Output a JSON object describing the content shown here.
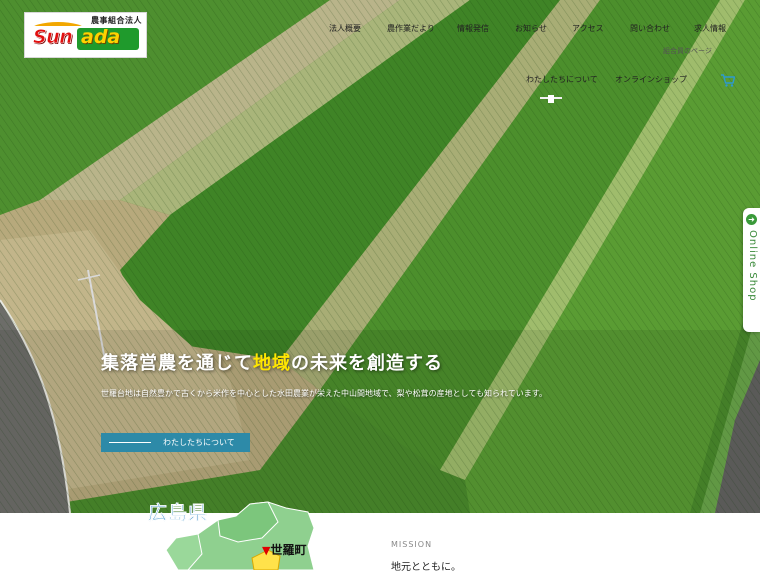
{
  "logo": {
    "subtitle": "農事組合法人",
    "brand_red": "Sun",
    "brand_yellow": "ada"
  },
  "nav": {
    "items": [
      {
        "label": "法人概要"
      },
      {
        "label": "農作業だより"
      },
      {
        "label": "情報発信"
      },
      {
        "label": "お知らせ"
      },
      {
        "label": "アクセス"
      },
      {
        "label": "問い合わせ"
      },
      {
        "label": "求人情報"
      }
    ],
    "member_label": "組合員のページ",
    "sub_items": [
      {
        "label": "わたしたちについて"
      },
      {
        "label": "オンラインショップ"
      }
    ]
  },
  "online_shop_tab": {
    "label": "Online Shop",
    "icon": "arrow-right-icon"
  },
  "hero": {
    "headline_pre": "集落営農を通じて",
    "headline_highlight": "地域",
    "headline_post": "の未来を創造する",
    "lead": "世羅台地は自然豊かで古くから米作を中心とした水田農業が栄えた中山間地域で、梨や松茸の産地としても知られています。",
    "cta_label": "わたしたちについて"
  },
  "map_section": {
    "prefecture": "広島県",
    "town": "世羅町"
  },
  "mission": {
    "eyebrow": "MISSION",
    "title": "地元とともに。"
  },
  "colors": {
    "accent_teal": "#2d8aa8",
    "highlight_yellow": "#ffe600",
    "brand_green": "#1f9a2c",
    "brand_red": "#e10f0f",
    "prefecture_blue": "#1f7fc2"
  }
}
